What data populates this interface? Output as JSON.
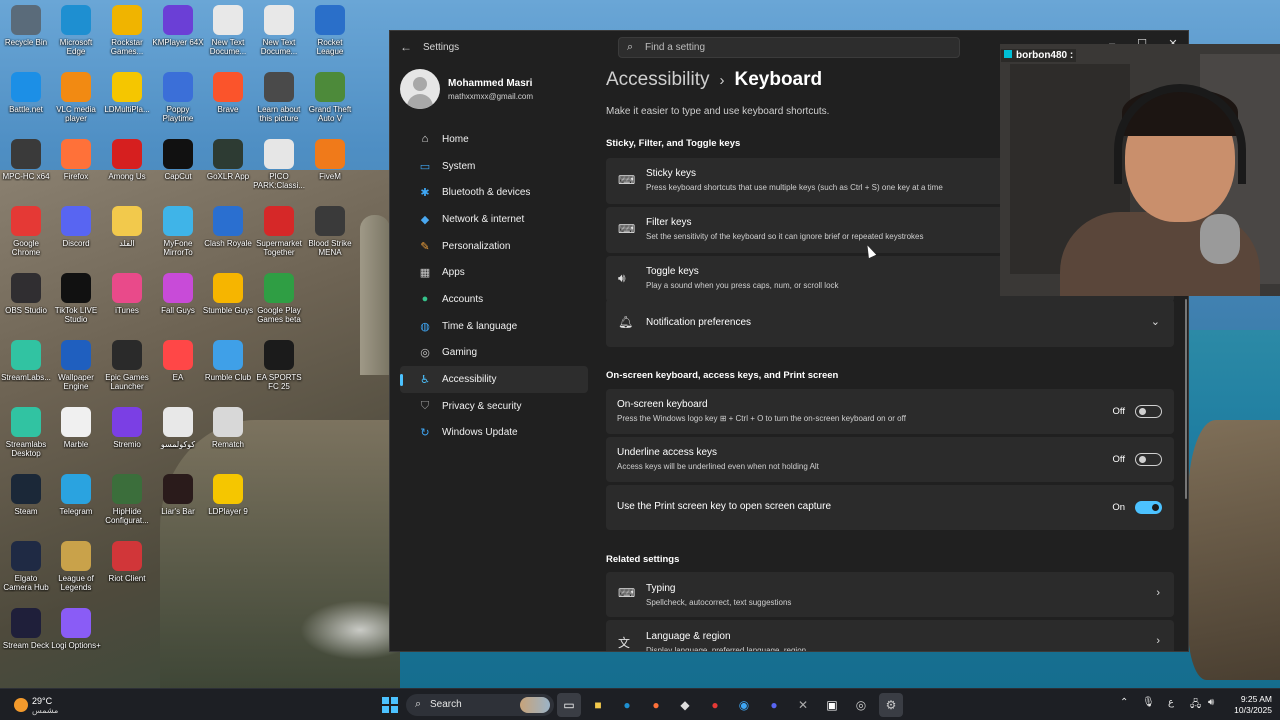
{
  "desktop": {
    "icons": [
      {
        "label": "Recycle Bin",
        "icon": "recycle-bin-icon",
        "color": "#5a6b7a"
      },
      {
        "label": "Microsoft Edge",
        "icon": "edge-icon",
        "color": "#1e8fd1"
      },
      {
        "label": "Rockstar Games...",
        "icon": "rockstar-icon",
        "color": "#f0b400"
      },
      {
        "label": "KMPlayer 64X",
        "icon": "kmplayer-icon",
        "color": "#6b3fd6"
      },
      {
        "label": "New Text Docume...",
        "icon": "text-file-icon",
        "color": "#e8e8e8"
      },
      {
        "label": "New Text Docume...",
        "icon": "text-file-icon",
        "color": "#e8e8e8"
      },
      {
        "label": "Rocket League",
        "icon": "rocket-league-icon",
        "color": "#2a6fc9"
      },
      {
        "label": "Battle.net",
        "icon": "battlenet-icon",
        "color": "#1c8fe6"
      },
      {
        "label": "VLC media player",
        "icon": "vlc-icon",
        "color": "#f28a12"
      },
      {
        "label": "LDMultiPla...",
        "icon": "ldmultiplayer-icon",
        "color": "#f5c600"
      },
      {
        "label": "Poppy Playtime",
        "icon": "poppy-playtime-icon",
        "color": "#3b6fd8"
      },
      {
        "label": "Brave",
        "icon": "brave-icon",
        "color": "#fb542b"
      },
      {
        "label": "Learn about this picture",
        "icon": "camera-icon",
        "color": "#4a4a4a"
      },
      {
        "label": "Grand Theft Auto V",
        "icon": "gta-icon",
        "color": "#4d8a3a"
      },
      {
        "label": "MPC-HC x64",
        "icon": "mpc-icon",
        "color": "#3a3a3a"
      },
      {
        "label": "Firefox",
        "icon": "firefox-icon",
        "color": "#ff7139"
      },
      {
        "label": "Among Us",
        "icon": "among-us-icon",
        "color": "#d61f1f"
      },
      {
        "label": "CapCut",
        "icon": "capcut-icon",
        "color": "#111111"
      },
      {
        "label": "GoXLR App",
        "icon": "goxlr-icon",
        "color": "#2d3b33"
      },
      {
        "label": "PICO PARK:Classi...",
        "icon": "pico-park-icon",
        "color": "#e6e6e6"
      },
      {
        "label": "FiveM",
        "icon": "fivem-icon",
        "color": "#f07a1a"
      },
      {
        "label": "Google Chrome",
        "icon": "chrome-icon",
        "color": "#e53935"
      },
      {
        "label": "Discord",
        "icon": "discord-icon",
        "color": "#5865f2"
      },
      {
        "label": "الفلد",
        "icon": "folder-icon",
        "color": "#f2c94c"
      },
      {
        "label": "MyFone MirrorTo",
        "icon": "mirrorto-icon",
        "color": "#3fb4e8"
      },
      {
        "label": "Clash Royale",
        "icon": "clash-royale-icon",
        "color": "#2a6fd0"
      },
      {
        "label": "Supermarket Together",
        "icon": "supermarket-icon",
        "color": "#d62828"
      },
      {
        "label": "Blood Strike MENA",
        "icon": "blood-strike-icon",
        "color": "#3a3a3a"
      },
      {
        "label": "OBS Studio",
        "icon": "obs-icon",
        "color": "#302e31"
      },
      {
        "label": "TikTok LIVE Studio",
        "icon": "tiktok-icon",
        "color": "#111111"
      },
      {
        "label": "iTunes",
        "icon": "itunes-icon",
        "color": "#e94a8a"
      },
      {
        "label": "Fall Guys",
        "icon": "fall-guys-icon",
        "color": "#c84bd8"
      },
      {
        "label": "Stumble Guys",
        "icon": "stumble-guys-icon",
        "color": "#f6b500"
      },
      {
        "label": "Google Play Games beta",
        "icon": "google-play-icon",
        "color": "#2f9e44"
      },
      {
        "label": "StreamLabs...",
        "icon": "streamlabs-icon",
        "color": "#31c3a2"
      },
      {
        "label": "Wallpaper Engine",
        "icon": "wallpaper-engine-icon",
        "color": "#1f5fbf"
      },
      {
        "label": "Epic Games Launcher",
        "icon": "epic-games-icon",
        "color": "#2a2a2a"
      },
      {
        "label": "EA",
        "icon": "ea-icon",
        "color": "#ff4747"
      },
      {
        "label": "Rumble Club",
        "icon": "rumble-club-icon",
        "color": "#3fa0e8"
      },
      {
        "label": "EA SPORTS FC 25",
        "icon": "ea-sports-icon",
        "color": "#1b1b1b"
      },
      {
        "label": "Streamlabs Desktop",
        "icon": "streamlabs-desktop-icon",
        "color": "#31c3a2"
      },
      {
        "label": "Marble",
        "icon": "marble-icon",
        "color": "#f0f0f0"
      },
      {
        "label": "Stremio",
        "icon": "stremio-icon",
        "color": "#7b3fe4"
      },
      {
        "label": "كوكولمسو",
        "icon": "text-file-icon",
        "color": "#e8e8e8"
      },
      {
        "label": "Rematch",
        "icon": "rematch-icon",
        "color": "#d8d8d8"
      },
      {
        "label": "Steam",
        "icon": "steam-icon",
        "color": "#1b2838"
      },
      {
        "label": "Telegram",
        "icon": "telegram-icon",
        "color": "#2aa3e0"
      },
      {
        "label": "HipHide Configurat...",
        "icon": "hiphide-icon",
        "color": "#3b6e3b"
      },
      {
        "label": "Liar's Bar",
        "icon": "liars-bar-icon",
        "color": "#2a1b1b"
      },
      {
        "label": "LDPlayer 9",
        "icon": "ldplayer-icon",
        "color": "#f5c600"
      },
      {
        "label": "Elgato Camera Hub",
        "icon": "elgato-icon",
        "color": "#1f2a44"
      },
      {
        "label": "League of Legends",
        "icon": "league-icon",
        "color": "#c9a24a"
      },
      {
        "label": "Riot Client",
        "icon": "riot-client-icon",
        "color": "#d13639"
      },
      {
        "label": "Stream Deck",
        "icon": "stream-deck-icon",
        "color": "#1f1f3a"
      },
      {
        "label": "Logi Options+",
        "icon": "logi-options-icon",
        "color": "#8a5cf6"
      }
    ]
  },
  "settings": {
    "app_title": "Settings",
    "search_placeholder": "Find a setting",
    "profile": {
      "name": "Mohammed Masri",
      "email": "mathxxmxx@gmail.com"
    },
    "nav": [
      {
        "label": "Home",
        "icon": "home-icon",
        "color": "#e8e8e8",
        "active": false
      },
      {
        "label": "System",
        "icon": "system-icon",
        "color": "#3fa7f5",
        "active": false
      },
      {
        "label": "Bluetooth & devices",
        "icon": "bluetooth-icon",
        "color": "#3fa7f5",
        "active": false
      },
      {
        "label": "Network & internet",
        "icon": "network-icon",
        "color": "#4aa8f0",
        "active": false
      },
      {
        "label": "Personalization",
        "icon": "brush-icon",
        "color": "#f0a03a",
        "active": false
      },
      {
        "label": "Apps",
        "icon": "apps-icon",
        "color": "#c9c9c9",
        "active": false
      },
      {
        "label": "Accounts",
        "icon": "accounts-icon",
        "color": "#35c28a",
        "active": false
      },
      {
        "label": "Time & language",
        "icon": "globe-icon",
        "color": "#3fa7f5",
        "active": false
      },
      {
        "label": "Gaming",
        "icon": "gaming-icon",
        "color": "#c9c9c9",
        "active": false
      },
      {
        "label": "Accessibility",
        "icon": "accessibility-icon",
        "color": "#4cc2ff",
        "active": true
      },
      {
        "label": "Privacy & security",
        "icon": "shield-icon",
        "color": "#9a9a9a",
        "active": false
      },
      {
        "label": "Windows Update",
        "icon": "update-icon",
        "color": "#3fa7f5",
        "active": false
      }
    ],
    "breadcrumb": {
      "parent": "Accessibility",
      "separator": "›",
      "current": "Keyboard"
    },
    "subtitle": "Make it easier to type and use keyboard shortcuts.",
    "section1_title": "Sticky, Filter, and Toggle keys",
    "keys": [
      {
        "title": "Sticky keys",
        "desc": "Press keyboard shortcuts that use multiple keys (such as Ctrl + S) one key at a time",
        "icon": "keyboard-icon"
      },
      {
        "title": "Filter keys",
        "desc": "Set the sensitivity of the keyboard so it can ignore brief or repeated keystrokes",
        "icon": "filter-keys-icon"
      },
      {
        "title": "Toggle keys",
        "desc": "Play a sound when you press caps, num, or scroll lock",
        "icon": "speaker-icon"
      }
    ],
    "notification_preferences": "Notification preferences",
    "section2_title": "On-screen keyboard, access keys, and Print screen",
    "toggles": [
      {
        "title": "On-screen keyboard",
        "desc": "Press the Windows logo key ⊞ + Ctrl + O to turn the on-screen keyboard on or off",
        "state": "Off",
        "on": false
      },
      {
        "title": "Underline access keys",
        "desc": "Access keys will be underlined even when not holding Alt",
        "state": "Off",
        "on": false
      },
      {
        "title": "Use the Print screen key to open screen capture",
        "desc": "",
        "state": "On",
        "on": true
      }
    ],
    "related_title": "Related settings",
    "related": [
      {
        "title": "Typing",
        "desc": "Spellcheck, autocorrect, text suggestions",
        "icon": "keyboard-icon"
      },
      {
        "title": "Language & region",
        "desc": "Display language, preferred language, region",
        "icon": "language-icon"
      }
    ],
    "accent": "#4cc2ff"
  },
  "webcam": {
    "label": "borbon480 :"
  },
  "taskbar": {
    "weather_temp": "29°C",
    "weather_cond": "مشمس",
    "search_label": "Search",
    "tray_lang": "ع",
    "time": "9:25 AM",
    "date": "10/3/2025"
  }
}
